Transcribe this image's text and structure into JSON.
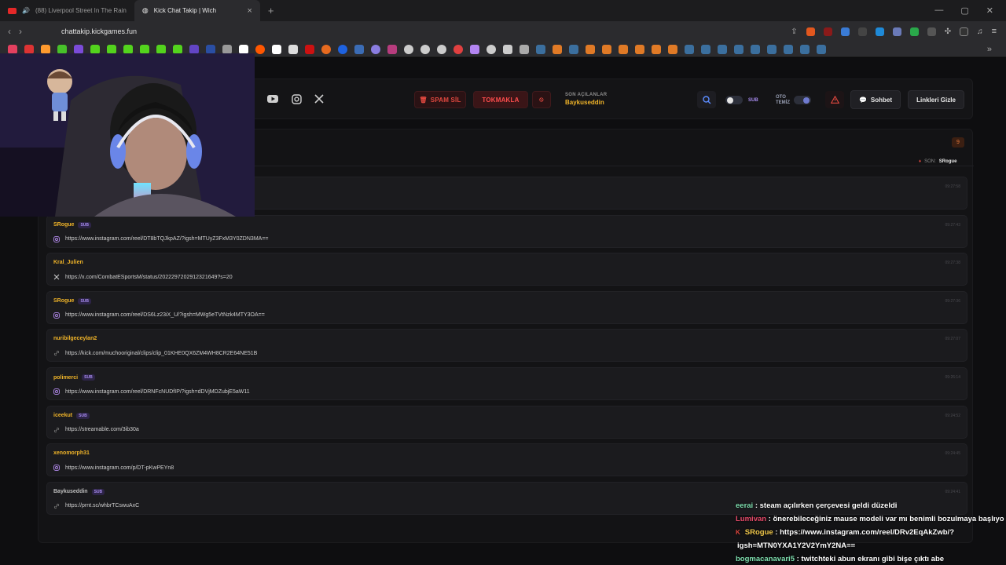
{
  "browser": {
    "tabs": [
      {
        "label": "(88) Liverpool Street In The Rain",
        "active": false
      },
      {
        "label": "Kick Chat Takip | Wich",
        "active": true
      }
    ],
    "url": "chattakip.kickgames.fun"
  },
  "header": {
    "spam_label": "SPAM SİL",
    "tokmakla_label": "TOKMAKLA",
    "recent_title": "SON AÇILANLAR",
    "recent_user": "Baykuseddin",
    "sub_label": "SUB",
    "oto_label_1": "OTO",
    "oto_label_2": "TEMİZ",
    "chat_button": "Sohbet",
    "hide_links_button": "Linkleri Gizle"
  },
  "feed": {
    "count": "9",
    "last_label": "SON:",
    "last_user": "SRogue",
    "rows": [
      {
        "user": "",
        "sub": false,
        "link": "mY2NA==",
        "icon": "instagram-icon",
        "time": "09:27:58",
        "color": "#f0b429"
      },
      {
        "user": "SRogue",
        "sub": true,
        "link": "https://www.instagram.com/reel/DT8bTQJkpAZ/?igsh=MTUyZ3FxM3Y0ZDN3MA==",
        "icon": "instagram-icon",
        "time": "09:27:43",
        "color": "#f0b429"
      },
      {
        "user": "Kral_Julien",
        "sub": false,
        "link": "https://x.com/CombatESportsM/status/2022297202912321649?s=20",
        "icon": "x-icon",
        "time": "09:27:38",
        "color": "#f0b429"
      },
      {
        "user": "SRogue",
        "sub": true,
        "link": "https://www.instagram.com/reel/DS6Lz23iX_U/?igsh=MWg5eTVtNzk4MTY3OA==",
        "icon": "instagram-icon",
        "time": "09:27:36",
        "color": "#f0b429"
      },
      {
        "user": "nuribilgeceylan2",
        "sub": false,
        "link": "https://kick.com/muchooriginal/clips/clip_01KHE0QX6ZM4WH8CR2E64NE51B",
        "icon": "link-icon",
        "time": "09:27:07",
        "color": "#f0b429"
      },
      {
        "user": "polimerci",
        "sub": true,
        "link": "https://www.instagram.com/reel/DRNFcNUDfIP/?igsh=dDVjMDZubjE5aW11",
        "icon": "instagram-icon",
        "time": "09:26:14",
        "color": "#f0b429"
      },
      {
        "user": "iceekut",
        "sub": true,
        "link": "https://streamable.com/3ib30a",
        "icon": "link-icon",
        "time": "09:24:52",
        "color": "#f0b429"
      },
      {
        "user": "xenomorph31",
        "sub": false,
        "link": "https://www.instagram.com/p/DT-pKwPEYn8",
        "icon": "instagram-icon",
        "time": "09:24:45",
        "color": "#f0b429"
      },
      {
        "user": "Baykuseddin",
        "sub": true,
        "link": "https://prnt.sc/whbrTCswuAxC",
        "icon": "link-icon",
        "time": "09:24:41",
        "color": "#bdbdbd"
      }
    ]
  },
  "chat_overlay": [
    {
      "user": "eerai",
      "text": " : steam açılırken çerçevesi geldi düzeldi",
      "color": "#7fe0b0",
      "prefix": ""
    },
    {
      "user": "Lumivan",
      "text": " : önerebileceğiniz mause modeli var mı benimli bozulmaya başlıyo",
      "color": "#e84a6a",
      "prefix": ""
    },
    {
      "user": "SRogue",
      "text": " : https://www.instagram.com/reel/DRv2EqAkZwb/?",
      "color": "#f2c94c",
      "prefix": "K"
    },
    {
      "user": "",
      "text": "igsh=MTN0YXA1Y2V2YmY2NA==",
      "color": "#ffffff",
      "prefix": ""
    },
    {
      "user": "bogmacanavari5",
      "text": " : twitchteki abun ekranı gibi bişe çıktı abe",
      "color": "#7fe0b0",
      "prefix": ""
    }
  ]
}
